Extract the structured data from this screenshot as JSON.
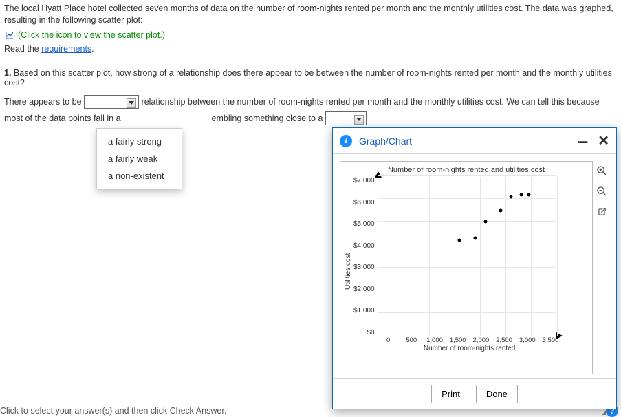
{
  "intro": "The local Hyatt Place hotel collected seven months of data on the number of room-nights rented per month and the monthly utilities cost. The data was graphed, resulting in the following scatter plot:",
  "icon_hint": "(Click the icon to view the scatter plot.)",
  "read_prefix": "Read the ",
  "read_link": "requirements",
  "read_suffix": ".",
  "q1_num": "1.",
  "q1_text": " Based on this scatter plot, how strong of a relationship does there appear to be between the number of room-nights rented per month and the monthly utilities cost?",
  "ans_a": "There appears to be ",
  "ans_b": " relationship between the number of room-nights rented per month and the monthly utilities cost.  We can tell this because most of the data points fall in a ",
  "ans_c": "embling something close to a ",
  "dropdown": {
    "opt1": "a fairly strong",
    "opt2": "a fairly weak",
    "opt3": "a non-existent"
  },
  "bottom_hint": "Click to select your answer(s) and then click Check Answer.",
  "popup": {
    "title": "Graph/Chart",
    "print": "Print",
    "done": "Done"
  },
  "chart_data": {
    "type": "scatter",
    "title": "Number of room-nights rented and utilities cost",
    "xlabel": "Number of room-nights rented",
    "ylabel": "Utilities cost",
    "xlim": [
      0,
      3500
    ],
    "ylim": [
      0,
      7000
    ],
    "xticks": [
      "0",
      "500",
      "1,000",
      "1,500",
      "2,000",
      "2,500",
      "3,000",
      "3,500"
    ],
    "yticks": [
      "$7,000",
      "$6,000",
      "$5,000",
      "$4,000",
      "$3,000",
      "$2,000",
      "$1,000",
      "$0"
    ],
    "points": [
      {
        "x": 1600,
        "y": 4200
      },
      {
        "x": 1900,
        "y": 4300
      },
      {
        "x": 2100,
        "y": 5000
      },
      {
        "x": 2400,
        "y": 5500
      },
      {
        "x": 2600,
        "y": 6100
      },
      {
        "x": 2800,
        "y": 6200
      },
      {
        "x": 2950,
        "y": 6200
      }
    ]
  }
}
